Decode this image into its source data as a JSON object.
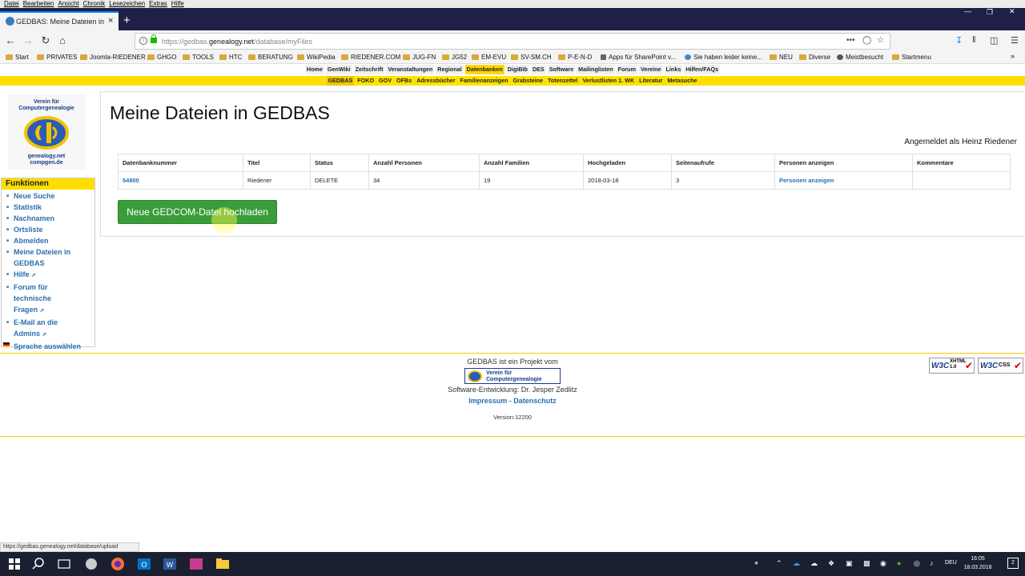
{
  "os_menu": [
    "Datei",
    "Bearbeiten",
    "Ansicht",
    "Chronik",
    "Lesezeichen",
    "Extras",
    "Hilfe"
  ],
  "tab": {
    "title": "GEDBAS: Meine Dateien in GEDBAS",
    "close": "×",
    "new_tab": "+"
  },
  "address": {
    "prefix": "https://gedbas.",
    "domain": "genealogy.net",
    "path": "/database/myFiles",
    "more": "•••"
  },
  "bookmarks": [
    "Start",
    "PRIVATES",
    "Joomla-RIEDENER",
    "GHGO",
    "TOOLS",
    "HTC",
    "BERATUNG",
    "WikiPedia",
    "RIEDENER.COM",
    "JUG-FN",
    "JG52",
    "EM-EVU",
    "SV-SM.CH",
    "P-E-N-D",
    "Apps für SharePoint v...",
    "Sie haben leider keine...",
    "NEU",
    "Diverse",
    "Meistbesucht",
    "Startmenu"
  ],
  "site_nav_primary": [
    "Home",
    "GenWiki",
    "Zeitschrift",
    "Veranstaltungen",
    "Regional",
    "Datenbanken",
    "DigiBib",
    "DES",
    "Software",
    "Mailinglisten",
    "Forum",
    "Vereine",
    "Links",
    "Hilfen/FAQs"
  ],
  "site_nav_primary_active": "Datenbanken",
  "site_nav_secondary": [
    "GEDBAS",
    "FOKO",
    "GOV",
    "OFBs",
    "Adressbücher",
    "Familienanzeigen",
    "Grabsteine",
    "Totenzettel",
    "Verlustlisten 1. WK",
    "Literatur",
    "Metasuche"
  ],
  "site_nav_secondary_active": "GEDBAS",
  "logo": {
    "top": "Verein für Computergenealogie",
    "bottom1": "genealogy.net",
    "bottom2": "compgen.de"
  },
  "sidebar": {
    "title": "Funktionen",
    "items": [
      "Neue Suche",
      "Statistik",
      "Nachnamen",
      "Ortsliste",
      "Abmelden",
      "Meine Dateien in GEDBAS",
      "Hilfe",
      "Forum für technische Fragen",
      "E-Mail an die Admins",
      "Sprache auswählen"
    ]
  },
  "main": {
    "title": "Meine Dateien in GEDBAS",
    "logged_in": "Angemeldet als Heinz Riedener",
    "table": {
      "headers": [
        "Datenbanknummer",
        "Titel",
        "Status",
        "Anzahl Personen",
        "Anzahl Familien",
        "Hochgeladen",
        "Seitenaufrufe",
        "Personen anzeigen",
        "Kommentare"
      ],
      "rows": [
        [
          "54800",
          "Riedener",
          "DELETE",
          "34",
          "19",
          "2018-03-18",
          "3",
          "Personen anzeigen",
          ""
        ]
      ]
    },
    "upload_button": "Neue GEDCOM-Datei hochladen"
  },
  "footer": {
    "line1": "GEDBAS ist ein Projekt vom",
    "logo_text1": "Verein für",
    "logo_text2": "Computergenealogie",
    "line2": "Software-Entwicklung: Dr. Jesper Zedlitz",
    "impressum": "Impressum",
    "sep": " - ",
    "datenschutz": "Datenschutz",
    "version": "Version:12200"
  },
  "badges": {
    "xhtml": "XHTML 1.0",
    "css": "CSS",
    "w3c": "W3C"
  },
  "status_url": "https://gedbas.genealogy.net/database/upload",
  "taskbar": {
    "lang": "DEU",
    "time": "16:05",
    "date": "18.03.2018",
    "notifications": "2"
  },
  "colors": {
    "accent_yellow": "#ffde00",
    "link_blue": "#2a6fb0",
    "button_green": "#3a9d3a",
    "tab_strip": "#1f1f47"
  }
}
